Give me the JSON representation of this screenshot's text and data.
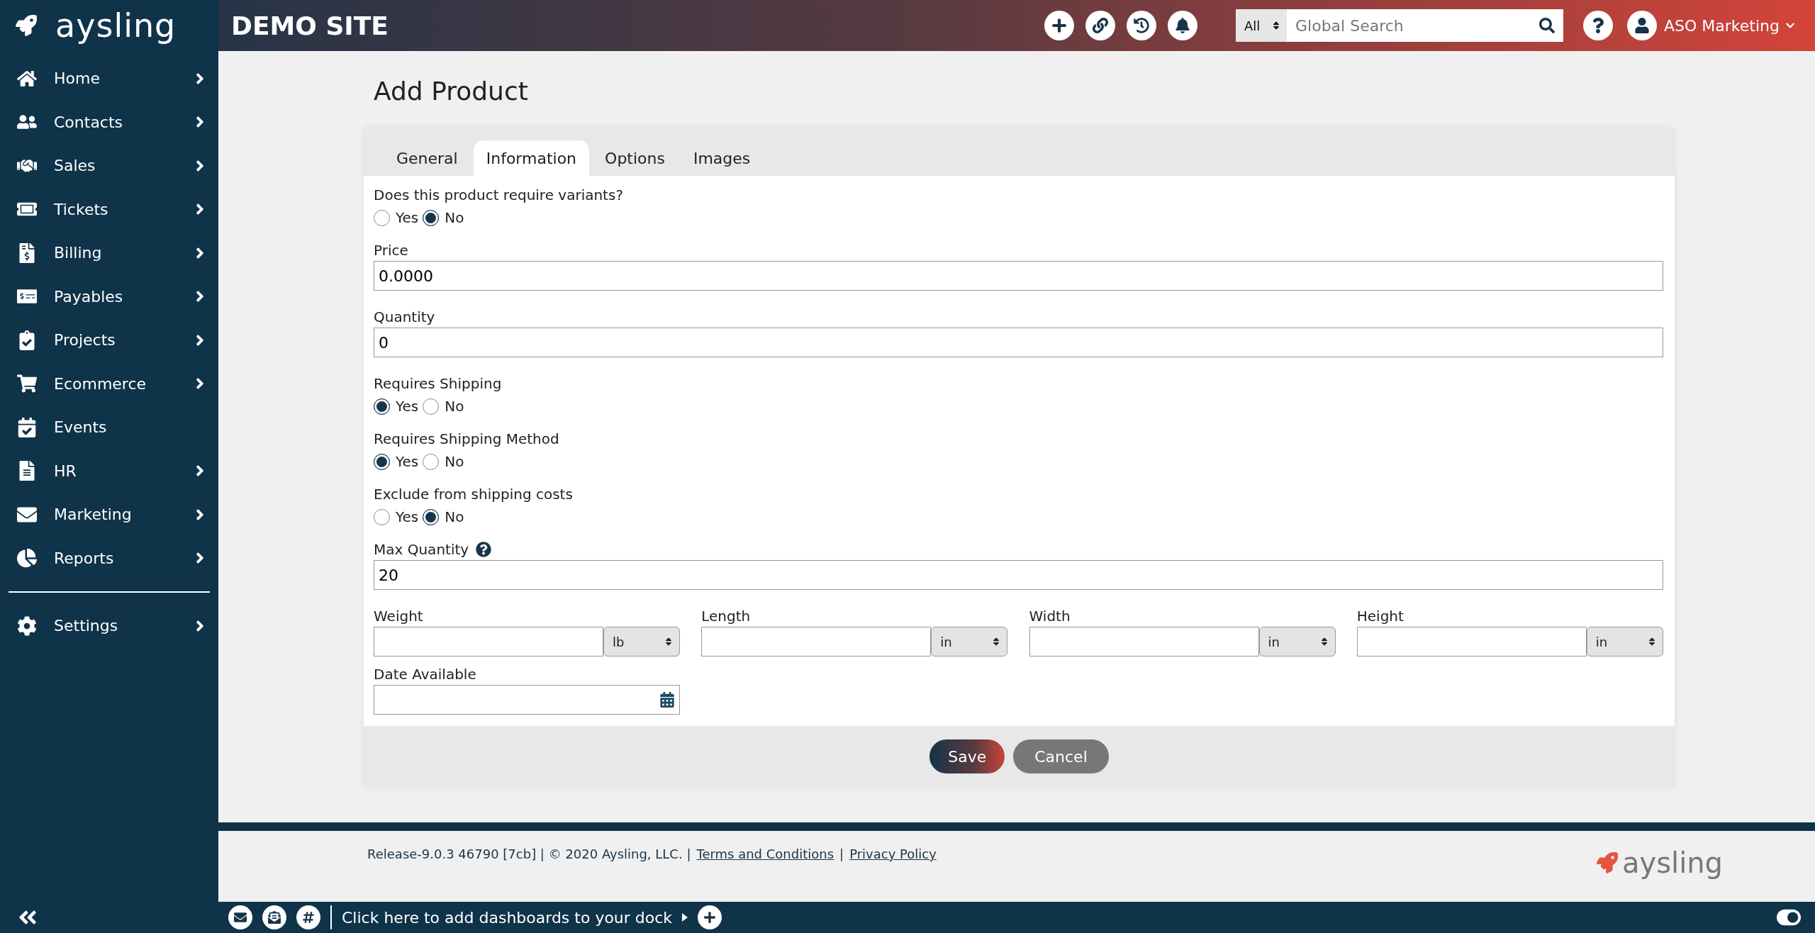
{
  "brand": {
    "logo_text": "aysling"
  },
  "header": {
    "site_title": "DEMO SITE",
    "search": {
      "scope": "All",
      "placeholder": "Global Search"
    },
    "user": "ASO Marketing"
  },
  "sidebar": {
    "items": [
      {
        "label": "Home",
        "has_submenu": true
      },
      {
        "label": "Contacts",
        "has_submenu": true
      },
      {
        "label": "Sales",
        "has_submenu": true
      },
      {
        "label": "Tickets",
        "has_submenu": true
      },
      {
        "label": "Billing",
        "has_submenu": true
      },
      {
        "label": "Payables",
        "has_submenu": true
      },
      {
        "label": "Projects",
        "has_submenu": true
      },
      {
        "label": "Ecommerce",
        "has_submenu": true
      },
      {
        "label": "Events",
        "has_submenu": false
      },
      {
        "label": "HR",
        "has_submenu": true
      },
      {
        "label": "Marketing",
        "has_submenu": true
      },
      {
        "label": "Reports",
        "has_submenu": true
      }
    ],
    "bottom_items": [
      {
        "label": "Settings",
        "has_submenu": true
      }
    ]
  },
  "page_title": "Add Product",
  "tabs": [
    {
      "label": "General",
      "selected": false
    },
    {
      "label": "Information",
      "selected": true
    },
    {
      "label": "Options",
      "selected": false
    },
    {
      "label": "Images",
      "selected": false
    }
  ],
  "fields": [
    {
      "kind": "radio",
      "label": "Does this product require variants?",
      "options": [
        {
          "label": "Yes",
          "selected": false
        },
        {
          "label": "No",
          "selected": true
        }
      ]
    },
    {
      "kind": "text",
      "label": "Price",
      "value": "0.0000",
      "help": false
    },
    {
      "kind": "text",
      "label": "Quantity",
      "value": "0",
      "help": false
    },
    {
      "kind": "radio",
      "label": "Requires Shipping",
      "options": [
        {
          "label": "Yes",
          "selected": true
        },
        {
          "label": "No",
          "selected": false
        }
      ]
    },
    {
      "kind": "radio",
      "label": "Requires Shipping Method",
      "options": [
        {
          "label": "Yes",
          "selected": true
        },
        {
          "label": "No",
          "selected": false
        }
      ]
    },
    {
      "kind": "radio",
      "label": "Exclude from shipping costs",
      "options": [
        {
          "label": "Yes",
          "selected": false
        },
        {
          "label": "No",
          "selected": true
        }
      ]
    },
    {
      "kind": "text",
      "label": "Max Quantity",
      "value": "20",
      "help": true
    },
    {
      "kind": "dimensions",
      "items": [
        {
          "label": "Weight",
          "unit": "lb"
        },
        {
          "label": "Length",
          "unit": "in"
        },
        {
          "label": "Width",
          "unit": "in"
        },
        {
          "label": "Height",
          "unit": "in"
        }
      ]
    },
    {
      "kind": "date",
      "label": "Date Available"
    }
  ],
  "buttons": [
    {
      "label": "Save",
      "kind": "primary"
    },
    {
      "label": "Cancel",
      "kind": "secondary"
    }
  ],
  "footer": {
    "release": "Release-9.0.3 46790 [7cb] | © 2020 Aysling, LLC. |",
    "links": [
      "Terms and Conditions",
      "Privacy Policy"
    ],
    "separator": "|",
    "logo_text": "aysling"
  },
  "dock": {
    "prompt": "Click here to add dashboards to your dock"
  }
}
